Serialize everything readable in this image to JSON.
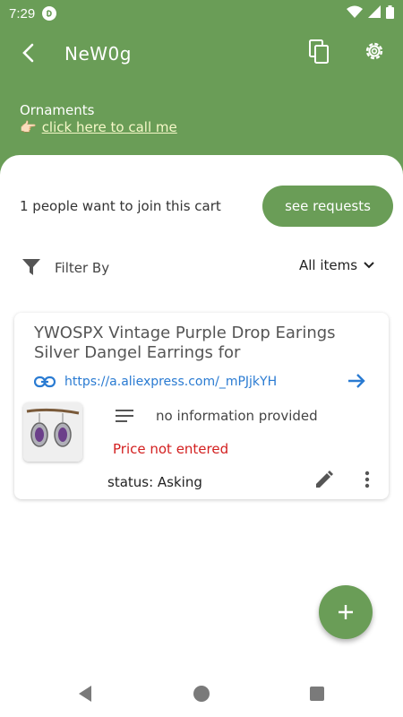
{
  "status_bar": {
    "time": "7:29"
  },
  "header": {
    "title": "NeW0g",
    "subtitle": "Ornaments",
    "call_emoji": "👉🏻",
    "call_link": "click here to call me"
  },
  "requests": {
    "text": "1 people want to join this cart",
    "button_label": "see requests"
  },
  "filter": {
    "label": "Filter By",
    "selected": "All items"
  },
  "item": {
    "title": "YWOSPX Vintage Purple Drop Earings Silver Dangel Earrings for",
    "link": "https://a.aliexpress.com/_mPJjkYH",
    "description": "no information provided",
    "price": "Price not entered",
    "status": "status: Asking"
  },
  "colors": {
    "primary": "#6a9d57",
    "link": "#2a7bd2",
    "error": "#d32020"
  },
  "icons": [
    "back-arrow-icon",
    "copy-icon",
    "gear-icon",
    "filter-icon",
    "chevron-down-icon",
    "link-icon",
    "arrow-right-icon",
    "description-icon",
    "edit-icon",
    "more-vert-icon",
    "plus-icon"
  ]
}
